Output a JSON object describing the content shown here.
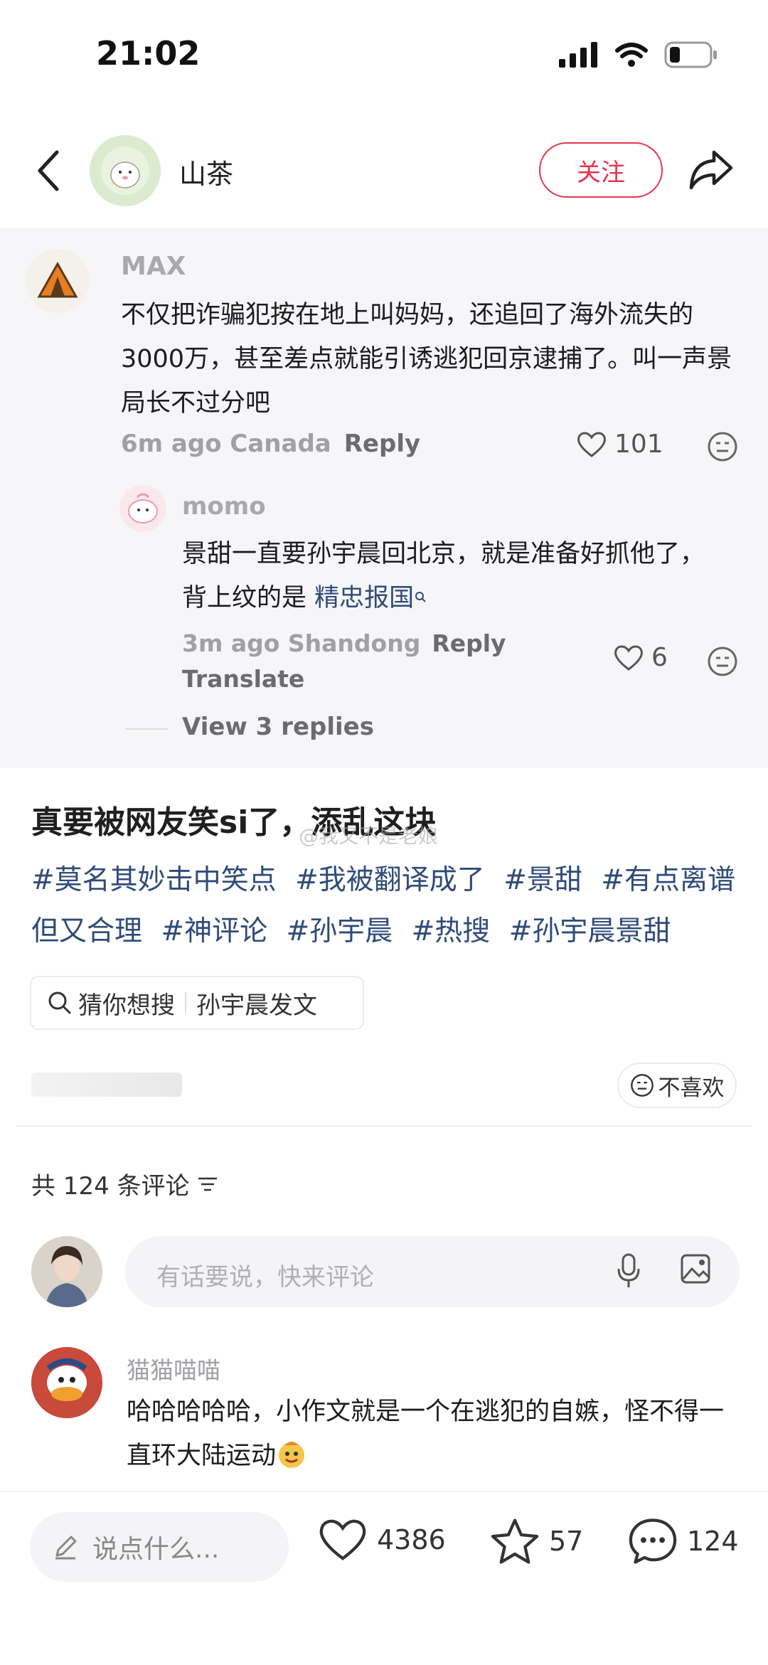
{
  "status": {
    "time": "21:02"
  },
  "topbar": {
    "author": "山茶",
    "follow_label": "关注"
  },
  "screenshot": {
    "comment": {
      "user": "MAX",
      "text": "不仅把诈骗犯按在地上叫妈妈，还追回了海外流失的3000万，甚至差点就能引诱逃犯回京逮捕了。叫一声景局长不过分吧",
      "meta": "6m ago Canada",
      "reply_label": "Reply",
      "likes": "101"
    },
    "reply": {
      "user": "momo",
      "text": "景甜一直要孙宇晨回北京，就是准备好抓他了，背上纹的是",
      "tag": "精忠报国",
      "meta": "3m ago Shandong",
      "reply_label": "Reply",
      "translate_label": "Translate",
      "likes": "6"
    },
    "view_replies": "View 3 replies"
  },
  "post": {
    "title": "真要被网友笑si了，添乱这块",
    "watermark": "@我又不是老娘",
    "tags": [
      "#莫名其妙击中笑点",
      "#我被翻译成了",
      "#景甜",
      "#有点离谱但又合理",
      "#神评论",
      "#孙宇晨",
      "#热搜",
      "#孙宇晨景甜"
    ]
  },
  "guess": {
    "label": "猜你想搜",
    "query": "孙宇晨发文"
  },
  "dislike_label": "不喜欢",
  "comments": {
    "count_label": "共 124 条评论",
    "input_placeholder": "有话要说，快来评论",
    "first": {
      "user": "猫猫喵喵",
      "text": "哈哈哈哈哈，小作文就是一个在逃犯的自嫉，怪不得一直环大陆运动"
    }
  },
  "bottom": {
    "say_placeholder": "说点什么...",
    "likes": "4386",
    "stars": "57",
    "comments": "124"
  },
  "colors": {
    "accent": "#e5344f",
    "tag": "#2f4b78"
  }
}
